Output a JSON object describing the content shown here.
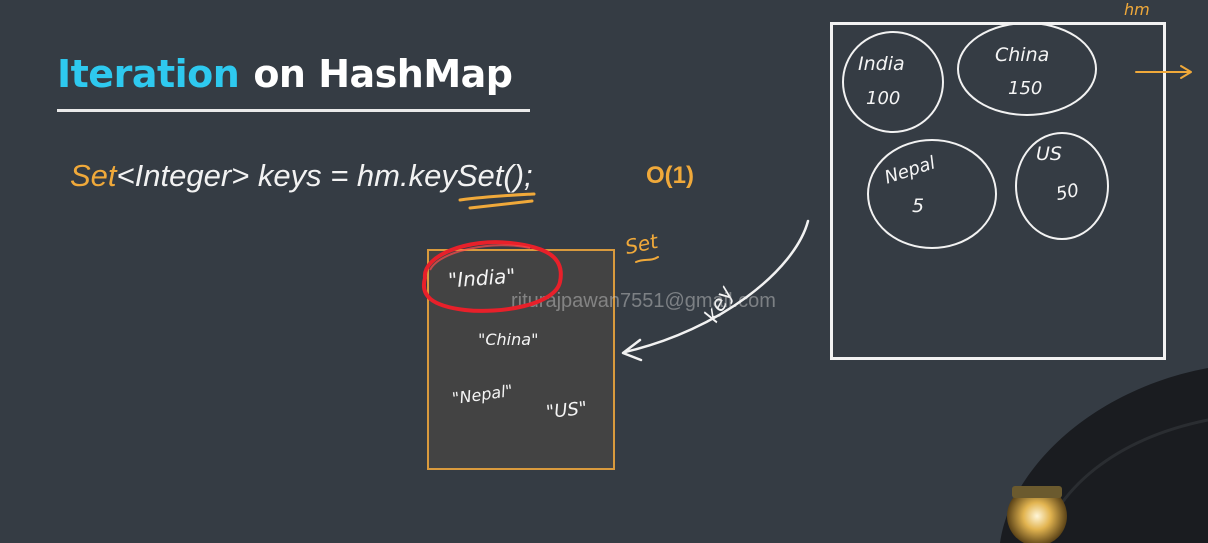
{
  "slide": {
    "title_part1": "Iteration",
    "title_part2": "on HashMap",
    "code": {
      "set_keyword": "Set",
      "rest": "<Integer> keys = hm.keySet();"
    },
    "complexity": "O(1)"
  },
  "set_box": {
    "label": "Set",
    "keys": [
      "\"India\"",
      "\"China\"",
      "\"Nepal\"",
      "\"US\""
    ],
    "arrow_label": "key"
  },
  "hashmap": {
    "label": "hm",
    "entries": [
      {
        "key": "India",
        "value": "100"
      },
      {
        "key": "China",
        "value": "150"
      },
      {
        "key": "Nepal",
        "value": "5"
      },
      {
        "key": "US",
        "value": "50"
      }
    ]
  },
  "watermark": "riturajpawan7551@gmail.com",
  "colors": {
    "background": "#353c44",
    "title_accent": "#2ec9ef",
    "keyword": "#f0a93a",
    "set_border": "#d99a3d",
    "highlight_circle": "#e8202a"
  }
}
